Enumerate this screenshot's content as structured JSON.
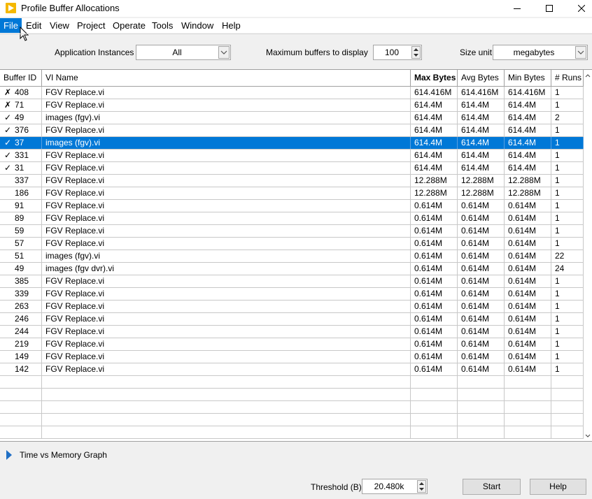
{
  "window": {
    "title": "Profile Buffer Allocations",
    "icons": [
      "labview-app-icon",
      "minimize-icon",
      "maximize-icon",
      "close-icon"
    ]
  },
  "menu": {
    "items": [
      "File",
      "Edit",
      "View",
      "Project",
      "Operate",
      "Tools",
      "Window",
      "Help"
    ],
    "active": "File"
  },
  "controls": {
    "app_instances_label": "Application Instances",
    "app_instances_value": "All",
    "max_buffers_label": "Maximum buffers to display",
    "max_buffers_value": "100",
    "size_unit_label": "Size unit",
    "size_unit_value": "megabytes"
  },
  "table": {
    "headers": [
      "Buffer ID",
      "VI Name",
      "Max Bytes",
      "Avg Bytes",
      "Min Bytes",
      "# Runs"
    ],
    "sorted_by": "Max Bytes",
    "rows": [
      {
        "mark": "✗",
        "id": "408",
        "name": "FGV Replace.vi",
        "max": "614.416M",
        "avg": "614.416M",
        "min": "614.416M",
        "runs": "1"
      },
      {
        "mark": "✗",
        "id": "71",
        "name": "FGV Replace.vi",
        "max": "614.4M",
        "avg": "614.4M",
        "min": "614.4M",
        "runs": "1"
      },
      {
        "mark": "✓",
        "id": "49",
        "name": "images (fgv).vi",
        "max": "614.4M",
        "avg": "614.4M",
        "min": "614.4M",
        "runs": "2"
      },
      {
        "mark": "✓",
        "id": "376",
        "name": "FGV Replace.vi",
        "max": "614.4M",
        "avg": "614.4M",
        "min": "614.4M",
        "runs": "1"
      },
      {
        "mark": "✓",
        "id": "37",
        "name": "images (fgv).vi",
        "max": "614.4M",
        "avg": "614.4M",
        "min": "614.4M",
        "runs": "1",
        "selected": true
      },
      {
        "mark": "✓",
        "id": "331",
        "name": "FGV Replace.vi",
        "max": "614.4M",
        "avg": "614.4M",
        "min": "614.4M",
        "runs": "1"
      },
      {
        "mark": "✓",
        "id": "31",
        "name": "FGV Replace.vi",
        "max": "614.4M",
        "avg": "614.4M",
        "min": "614.4M",
        "runs": "1"
      },
      {
        "mark": "",
        "id": "337",
        "name": "FGV Replace.vi",
        "max": "12.288M",
        "avg": "12.288M",
        "min": "12.288M",
        "runs": "1"
      },
      {
        "mark": "",
        "id": "186",
        "name": "FGV Replace.vi",
        "max": "12.288M",
        "avg": "12.288M",
        "min": "12.288M",
        "runs": "1"
      },
      {
        "mark": "",
        "id": "91",
        "name": "FGV Replace.vi",
        "max": "0.614M",
        "avg": "0.614M",
        "min": "0.614M",
        "runs": "1"
      },
      {
        "mark": "",
        "id": "89",
        "name": "FGV Replace.vi",
        "max": "0.614M",
        "avg": "0.614M",
        "min": "0.614M",
        "runs": "1"
      },
      {
        "mark": "",
        "id": "59",
        "name": "FGV Replace.vi",
        "max": "0.614M",
        "avg": "0.614M",
        "min": "0.614M",
        "runs": "1"
      },
      {
        "mark": "",
        "id": "57",
        "name": "FGV Replace.vi",
        "max": "0.614M",
        "avg": "0.614M",
        "min": "0.614M",
        "runs": "1"
      },
      {
        "mark": "",
        "id": "51",
        "name": "images (fgv).vi",
        "max": "0.614M",
        "avg": "0.614M",
        "min": "0.614M",
        "runs": "22"
      },
      {
        "mark": "",
        "id": "49",
        "name": "images (fgv dvr).vi",
        "max": "0.614M",
        "avg": "0.614M",
        "min": "0.614M",
        "runs": "24"
      },
      {
        "mark": "",
        "id": "385",
        "name": "FGV Replace.vi",
        "max": "0.614M",
        "avg": "0.614M",
        "min": "0.614M",
        "runs": "1"
      },
      {
        "mark": "",
        "id": "339",
        "name": "FGV Replace.vi",
        "max": "0.614M",
        "avg": "0.614M",
        "min": "0.614M",
        "runs": "1"
      },
      {
        "mark": "",
        "id": "263",
        "name": "FGV Replace.vi",
        "max": "0.614M",
        "avg": "0.614M",
        "min": "0.614M",
        "runs": "1"
      },
      {
        "mark": "",
        "id": "246",
        "name": "FGV Replace.vi",
        "max": "0.614M",
        "avg": "0.614M",
        "min": "0.614M",
        "runs": "1"
      },
      {
        "mark": "",
        "id": "244",
        "name": "FGV Replace.vi",
        "max": "0.614M",
        "avg": "0.614M",
        "min": "0.614M",
        "runs": "1"
      },
      {
        "mark": "",
        "id": "219",
        "name": "FGV Replace.vi",
        "max": "0.614M",
        "avg": "0.614M",
        "min": "0.614M",
        "runs": "1"
      },
      {
        "mark": "",
        "id": "149",
        "name": "FGV Replace.vi",
        "max": "0.614M",
        "avg": "0.614M",
        "min": "0.614M",
        "runs": "1"
      },
      {
        "mark": "",
        "id": "142",
        "name": "FGV Replace.vi",
        "max": "0.614M",
        "avg": "0.614M",
        "min": "0.614M",
        "runs": "1"
      }
    ]
  },
  "bottom": {
    "graph_label": "Time vs Memory Graph",
    "threshold_label": "Threshold (B)",
    "threshold_value": "20.480k",
    "start_label": "Start",
    "help_label": "Help"
  },
  "colors": {
    "selection": "#0078d7",
    "app_icon": "#f5b800",
    "graph_toggle": "#1f6fc5"
  }
}
